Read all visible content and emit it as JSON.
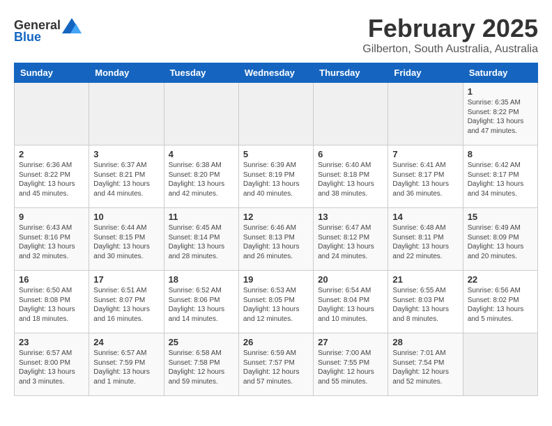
{
  "header": {
    "logo_general": "General",
    "logo_blue": "Blue",
    "title": "February 2025",
    "subtitle": "Gilberton, South Australia, Australia"
  },
  "days_of_week": [
    "Sunday",
    "Monday",
    "Tuesday",
    "Wednesday",
    "Thursday",
    "Friday",
    "Saturday"
  ],
  "weeks": [
    [
      {
        "day": "",
        "info": ""
      },
      {
        "day": "",
        "info": ""
      },
      {
        "day": "",
        "info": ""
      },
      {
        "day": "",
        "info": ""
      },
      {
        "day": "",
        "info": ""
      },
      {
        "day": "",
        "info": ""
      },
      {
        "day": "1",
        "info": "Sunrise: 6:35 AM\nSunset: 8:22 PM\nDaylight: 13 hours\nand 47 minutes."
      }
    ],
    [
      {
        "day": "2",
        "info": "Sunrise: 6:36 AM\nSunset: 8:22 PM\nDaylight: 13 hours\nand 45 minutes."
      },
      {
        "day": "3",
        "info": "Sunrise: 6:37 AM\nSunset: 8:21 PM\nDaylight: 13 hours\nand 44 minutes."
      },
      {
        "day": "4",
        "info": "Sunrise: 6:38 AM\nSunset: 8:20 PM\nDaylight: 13 hours\nand 42 minutes."
      },
      {
        "day": "5",
        "info": "Sunrise: 6:39 AM\nSunset: 8:19 PM\nDaylight: 13 hours\nand 40 minutes."
      },
      {
        "day": "6",
        "info": "Sunrise: 6:40 AM\nSunset: 8:18 PM\nDaylight: 13 hours\nand 38 minutes."
      },
      {
        "day": "7",
        "info": "Sunrise: 6:41 AM\nSunset: 8:17 PM\nDaylight: 13 hours\nand 36 minutes."
      },
      {
        "day": "8",
        "info": "Sunrise: 6:42 AM\nSunset: 8:17 PM\nDaylight: 13 hours\nand 34 minutes."
      }
    ],
    [
      {
        "day": "9",
        "info": "Sunrise: 6:43 AM\nSunset: 8:16 PM\nDaylight: 13 hours\nand 32 minutes."
      },
      {
        "day": "10",
        "info": "Sunrise: 6:44 AM\nSunset: 8:15 PM\nDaylight: 13 hours\nand 30 minutes."
      },
      {
        "day": "11",
        "info": "Sunrise: 6:45 AM\nSunset: 8:14 PM\nDaylight: 13 hours\nand 28 minutes."
      },
      {
        "day": "12",
        "info": "Sunrise: 6:46 AM\nSunset: 8:13 PM\nDaylight: 13 hours\nand 26 minutes."
      },
      {
        "day": "13",
        "info": "Sunrise: 6:47 AM\nSunset: 8:12 PM\nDaylight: 13 hours\nand 24 minutes."
      },
      {
        "day": "14",
        "info": "Sunrise: 6:48 AM\nSunset: 8:11 PM\nDaylight: 13 hours\nand 22 minutes."
      },
      {
        "day": "15",
        "info": "Sunrise: 6:49 AM\nSunset: 8:09 PM\nDaylight: 13 hours\nand 20 minutes."
      }
    ],
    [
      {
        "day": "16",
        "info": "Sunrise: 6:50 AM\nSunset: 8:08 PM\nDaylight: 13 hours\nand 18 minutes."
      },
      {
        "day": "17",
        "info": "Sunrise: 6:51 AM\nSunset: 8:07 PM\nDaylight: 13 hours\nand 16 minutes."
      },
      {
        "day": "18",
        "info": "Sunrise: 6:52 AM\nSunset: 8:06 PM\nDaylight: 13 hours\nand 14 minutes."
      },
      {
        "day": "19",
        "info": "Sunrise: 6:53 AM\nSunset: 8:05 PM\nDaylight: 13 hours\nand 12 minutes."
      },
      {
        "day": "20",
        "info": "Sunrise: 6:54 AM\nSunset: 8:04 PM\nDaylight: 13 hours\nand 10 minutes."
      },
      {
        "day": "21",
        "info": "Sunrise: 6:55 AM\nSunset: 8:03 PM\nDaylight: 13 hours\nand 8 minutes."
      },
      {
        "day": "22",
        "info": "Sunrise: 6:56 AM\nSunset: 8:02 PM\nDaylight: 13 hours\nand 5 minutes."
      }
    ],
    [
      {
        "day": "23",
        "info": "Sunrise: 6:57 AM\nSunset: 8:00 PM\nDaylight: 13 hours\nand 3 minutes."
      },
      {
        "day": "24",
        "info": "Sunrise: 6:57 AM\nSunset: 7:59 PM\nDaylight: 13 hours\nand 1 minute."
      },
      {
        "day": "25",
        "info": "Sunrise: 6:58 AM\nSunset: 7:58 PM\nDaylight: 12 hours\nand 59 minutes."
      },
      {
        "day": "26",
        "info": "Sunrise: 6:59 AM\nSunset: 7:57 PM\nDaylight: 12 hours\nand 57 minutes."
      },
      {
        "day": "27",
        "info": "Sunrise: 7:00 AM\nSunset: 7:55 PM\nDaylight: 12 hours\nand 55 minutes."
      },
      {
        "day": "28",
        "info": "Sunrise: 7:01 AM\nSunset: 7:54 PM\nDaylight: 12 hours\nand 52 minutes."
      },
      {
        "day": "",
        "info": ""
      }
    ]
  ]
}
